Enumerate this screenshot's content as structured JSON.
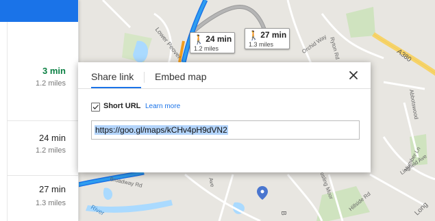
{
  "map": {
    "road_labels": {
      "lower_peover": "Lower Peover",
      "a380": "A380",
      "orchid_way": "Orchid Way",
      "ryton_rd": "Ryton Rd",
      "abbotswood": "Abbotswood",
      "humber_ln": "Humber Ln",
      "lingfield_ave": "Lingfield Ave",
      "broadway_rd": "Broadway Rd",
      "river": "River",
      "ave": "Ave",
      "gosling_moor": "Gosling Moor",
      "hillside_rd": "Hillside Rd",
      "long": "Long",
      "b": "B"
    },
    "walk_badges": [
      {
        "time": "24 min",
        "distance": "1.2 miles"
      },
      {
        "time": "27 min",
        "distance": "1.3 miles"
      }
    ]
  },
  "routes": [
    {
      "time": "3 min",
      "distance": "1.2 miles",
      "selected": true
    },
    {
      "time": "24 min",
      "distance": "1.2 miles",
      "selected": false
    },
    {
      "time": "27 min",
      "distance": "1.3 miles",
      "selected": false
    }
  ],
  "dialog": {
    "tabs": [
      "Share link",
      "Embed map"
    ],
    "active_tab": "Share link",
    "short_url_label": "Short URL",
    "short_url_checked": true,
    "learn_more": "Learn more",
    "url": "https://goo.gl/maps/kCHv4pH9dVN2"
  },
  "colors": {
    "accent": "#1a73e8",
    "route_selected": "#0b8043",
    "route_line": "#1a9ee8",
    "route_alt": "#9a9a9a"
  }
}
